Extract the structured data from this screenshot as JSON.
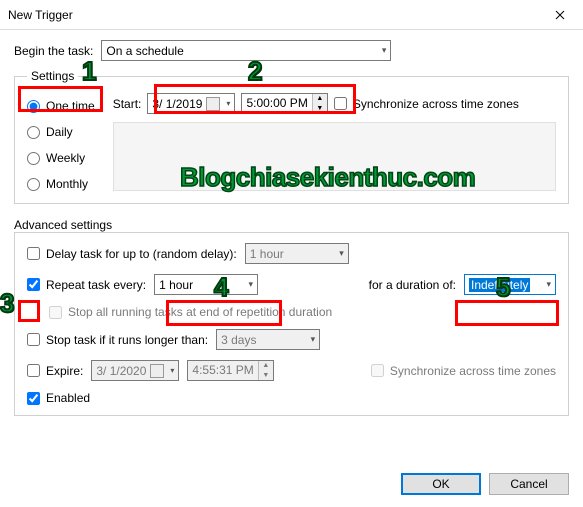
{
  "window": {
    "title": "New Trigger"
  },
  "begin": {
    "label": "Begin the task:",
    "value": "On a schedule"
  },
  "settings": {
    "legend": "Settings",
    "radios": {
      "one_time": "One time",
      "daily": "Daily",
      "weekly": "Weekly",
      "monthly": "Monthly"
    },
    "start_label": "Start:",
    "date": "3/ 1/2019",
    "time": "5:00:00 PM",
    "sync": "Synchronize across time zones"
  },
  "advanced": {
    "title": "Advanced settings",
    "delay_label": "Delay task for up to (random delay):",
    "delay_value": "1 hour",
    "repeat_label": "Repeat task every:",
    "repeat_value": "1 hour",
    "duration_label": "for a duration of:",
    "duration_value": "Indefinitely",
    "stop_all": "Stop all running tasks at end of repetition duration",
    "stop_if_label": "Stop task if it runs longer than:",
    "stop_if_value": "3 days",
    "expire_label": "Expire:",
    "expire_date": "3/ 1/2020",
    "expire_time": "4:55:31 PM",
    "sync2": "Synchronize across time zones",
    "enabled": "Enabled"
  },
  "buttons": {
    "ok": "OK",
    "cancel": "Cancel"
  },
  "annotations": {
    "n1": "1",
    "n2": "2",
    "n3": "3",
    "n4": "4",
    "n5": "5",
    "watermark": "Blogchiasekienthuc.com"
  }
}
